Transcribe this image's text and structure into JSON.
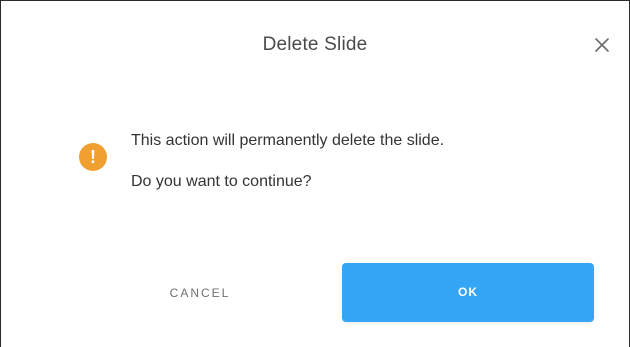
{
  "dialog": {
    "title": "Delete Slide",
    "close_icon": "close-icon",
    "warning_icon": "warning-icon",
    "warning_glyph": "!",
    "message_line1": "This action will permanently delete the slide.",
    "message_line2": "Do you want to continue?",
    "cancel_label": "CANCEL",
    "ok_label": "OK"
  },
  "colors": {
    "primary": "#34a6f5",
    "warning": "#f0a030",
    "title_text": "#4a4a4a",
    "body_text": "#333333",
    "cancel_text": "#6f6f6f"
  }
}
